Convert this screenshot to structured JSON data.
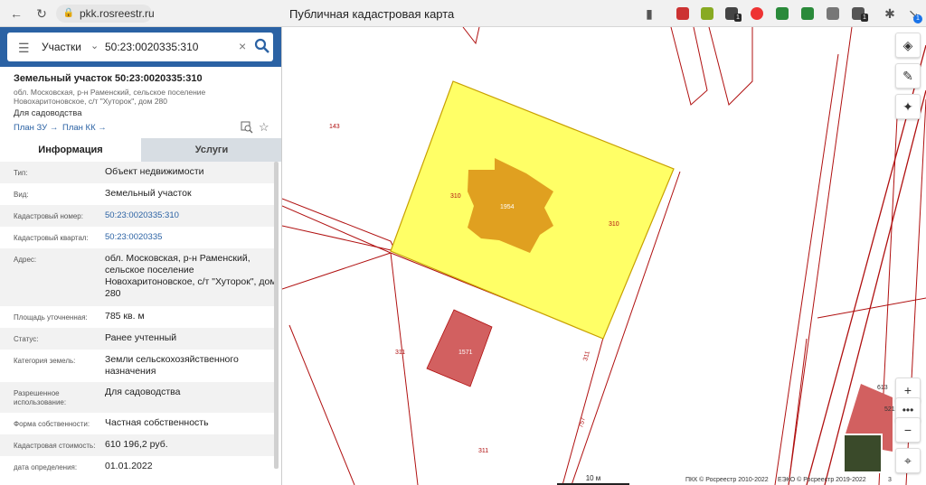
{
  "browser": {
    "url": "pkk.rosreestr.ru",
    "title": "Публичная кадастровая карта",
    "badge_count_1": "1",
    "badge_count_2": "1",
    "badge_count_3": "1"
  },
  "search": {
    "type_label": "Участки",
    "query": "50:23:0020335:310"
  },
  "object": {
    "title": "Земельный участок 50:23:0020335:310",
    "address_short": "обл. Московская, р-н Раменский, сельское поселение Новохаритоновское, с/т \"Хуторок\", дом 280",
    "use": "Для садоводства",
    "plan_zu": "План ЗУ",
    "plan_kk": "План КК"
  },
  "tabs": {
    "info": "Информация",
    "services": "Услуги"
  },
  "rows": [
    {
      "k": "Тип:",
      "v": "Объект недвижимости"
    },
    {
      "k": "Вид:",
      "v": "Земельный участок"
    },
    {
      "k": "Кадастровый номер:",
      "v": "50:23:0020335:310"
    },
    {
      "k": "Кадастровый квартал:",
      "v": "50:23:0020335"
    },
    {
      "k": "Адрес:",
      "v": "обл. Московская, р-н Раменский, сельское поселение Новохаритоновское, с/т \"Хуторок\", дом 280"
    },
    {
      "k": "Площадь уточненная:",
      "v": "785 кв. м"
    },
    {
      "k": "Статус:",
      "v": "Ранее учтенный"
    },
    {
      "k": "Категория земель:",
      "v": "Земли сельскохозяйственного назначения"
    },
    {
      "k": "Разрешенное использование:",
      "v": "Для садоводства"
    },
    {
      "k": "Форма собственности:",
      "v": "Частная собственность"
    },
    {
      "k": "Кадастровая стоимость:",
      "v": "610 196,2 руб."
    },
    {
      "k": "дата определения:",
      "v": "01.01.2022"
    }
  ],
  "map": {
    "labels": {
      "l143": "143",
      "l310a": "310",
      "l310b": "310",
      "l1954": "1954",
      "l311a": "311",
      "l311b": "311",
      "l311c": "311",
      "l1571": "1571",
      "l757": "757",
      "l613": "613",
      "l521": "521"
    },
    "scale": "10 м",
    "attribution_1": "ПКК © Росреестр 2010-2022",
    "attribution_2": "ЕЭКО © Росреестр 2019-2022",
    "attribution_3": "3",
    "colors": {
      "parcel_fill": "#ffff66",
      "parcel_stroke": "#c8a000",
      "building_fill": "#e0a020",
      "other_building": "#d26060",
      "boundary": "#b01010",
      "accent": "#2b62a4"
    }
  }
}
